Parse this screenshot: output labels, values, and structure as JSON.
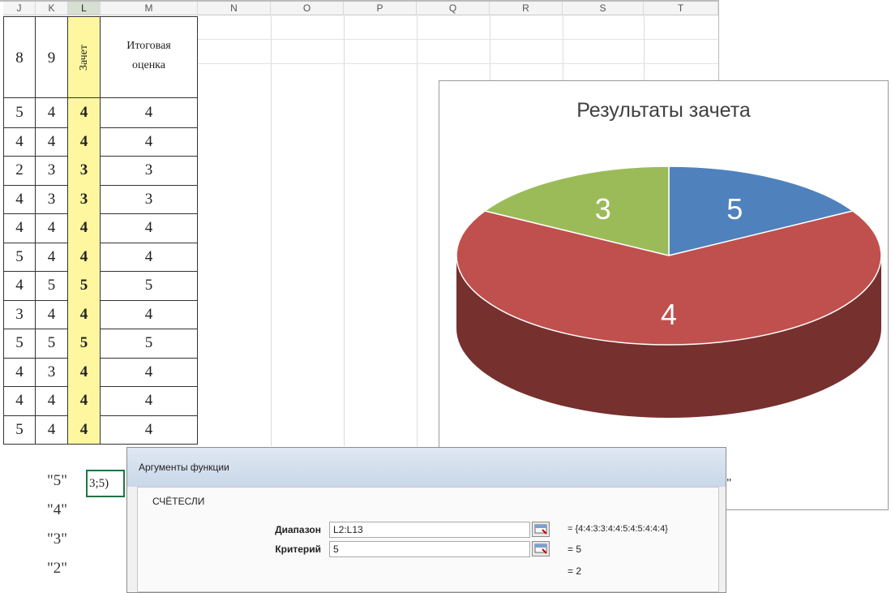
{
  "columns": [
    "J",
    "K",
    "L",
    "M",
    "N",
    "O",
    "P",
    "Q",
    "R",
    "S",
    "T"
  ],
  "header_row": {
    "j": "8",
    "k": "9",
    "l": "Зачет",
    "m_line1": "Итоговая",
    "m_line2": "оценка"
  },
  "rows": [
    [
      "5",
      "4",
      "4",
      "4"
    ],
    [
      "4",
      "4",
      "4",
      "4"
    ],
    [
      "2",
      "3",
      "3",
      "3"
    ],
    [
      "4",
      "3",
      "3",
      "3"
    ],
    [
      "4",
      "4",
      "4",
      "4"
    ],
    [
      "5",
      "4",
      "4",
      "4"
    ],
    [
      "4",
      "5",
      "5",
      "5"
    ],
    [
      "3",
      "4",
      "4",
      "4"
    ],
    [
      "5",
      "5",
      "5",
      "5"
    ],
    [
      "4",
      "3",
      "4",
      "4"
    ],
    [
      "4",
      "4",
      "4",
      "4"
    ],
    [
      "5",
      "4",
      "4",
      "4"
    ]
  ],
  "summary_labels": [
    "\"5\"",
    "\"4\"",
    "\"3\"",
    "\"2\""
  ],
  "active_cell_text": "3;5)",
  "chart_data": {
    "type": "pie",
    "title": "Результаты зачета",
    "categories": [
      "\"5\"",
      "\"4\"",
      "\"3\"",
      "\"2\""
    ],
    "values": [
      2,
      8,
      2,
      0
    ],
    "data_labels": [
      "5",
      "4",
      "3",
      ""
    ],
    "colors": [
      "#4f81bd",
      "#c0504d",
      "#9bbb59",
      "#8064a2"
    ],
    "legend_position": "bottom",
    "three_d": true
  },
  "dialog": {
    "title": "Аргументы функции",
    "function_name": "СЧЁТЕСЛИ",
    "range_label": "Диапазон",
    "range_value": "L2:L13",
    "range_result": "= {4:4:3:3:4:4:5:4:5:4:4:4}",
    "criteria_label": "Критерий",
    "criteria_value": "5",
    "criteria_result": "= 5",
    "bottom_result": "= 2"
  }
}
